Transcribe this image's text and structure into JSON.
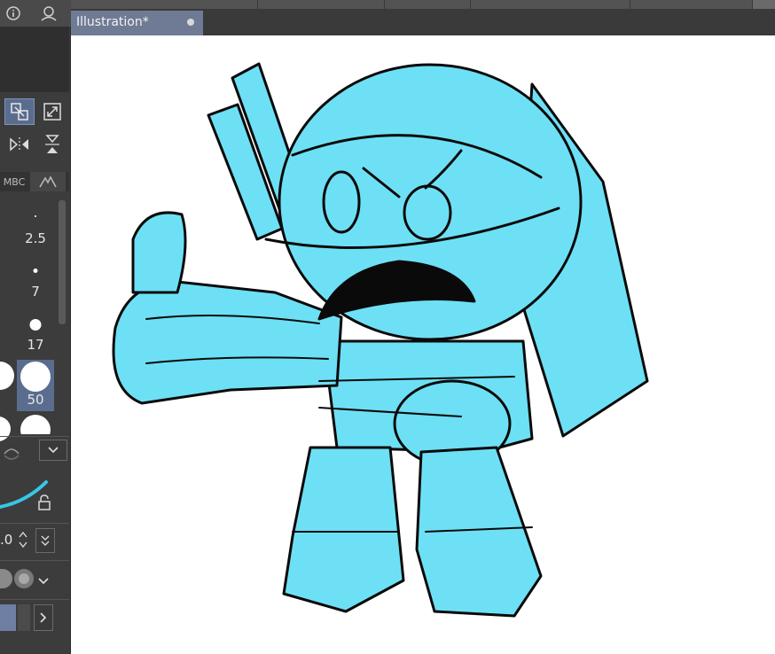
{
  "document": {
    "tab_title": "Illustration*",
    "colors": {
      "fill": "#6ee0f5",
      "line": "#0a0a0a",
      "canvas": "#ffffff",
      "tab": "#6f7a94"
    }
  },
  "left_panel": {
    "top_icons": [
      "info-icon",
      "user-icon"
    ],
    "transform_tools": [
      "scale-icon",
      "resize-icon",
      "flip-horizontal-icon",
      "flip-vertical-icon"
    ],
    "tabs": [
      "MBC",
      "mountain-icon"
    ],
    "brush_sizes": [
      {
        "label": "2.5"
      },
      {
        "label": "7"
      },
      {
        "label": "17"
      },
      {
        "label": "50",
        "selected": true
      }
    ],
    "value_readout": ".0"
  }
}
